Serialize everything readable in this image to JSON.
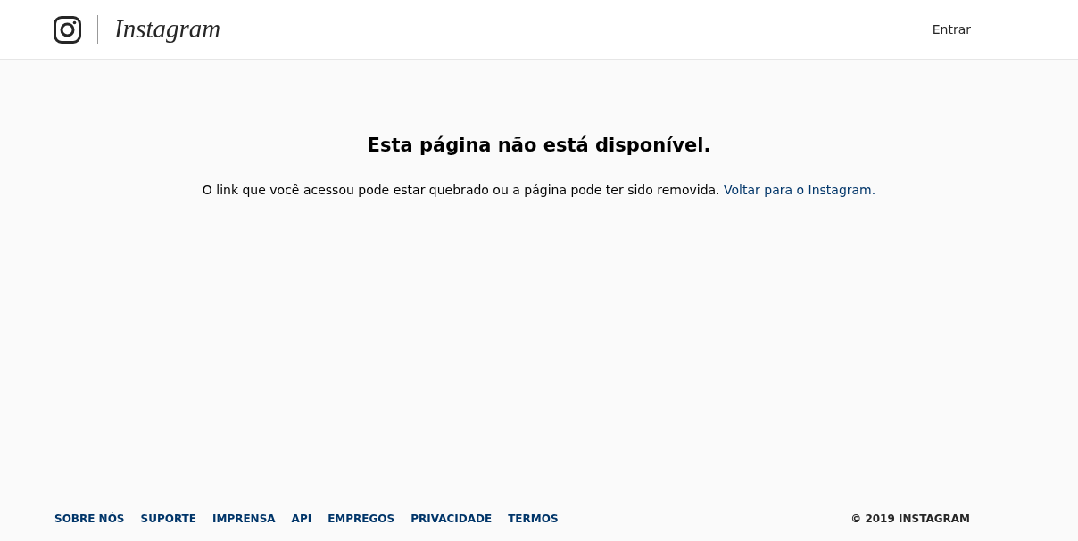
{
  "header": {
    "logo_text": "Instagram",
    "login": "Entrar"
  },
  "error": {
    "title": "Esta página não está disponível.",
    "message": "O link que você acessou pode estar quebrado ou a página pode ter sido removida.",
    "link": "Voltar para o Instagram."
  },
  "footer": {
    "links": [
      "SOBRE NÓS",
      "SUPORTE",
      "IMPRENSA",
      "API",
      "EMPREGOS",
      "PRIVACIDADE",
      "TERMOS"
    ],
    "copyright": "© 2019 INSTAGRAM"
  }
}
